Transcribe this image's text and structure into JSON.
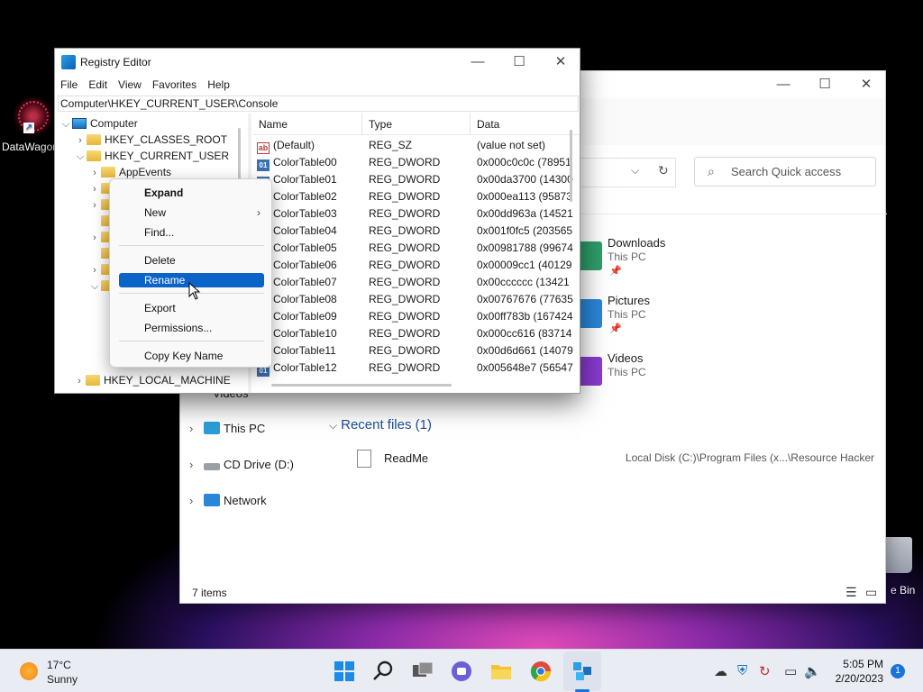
{
  "desktop": {
    "datawagon_label": "DataWagon",
    "bin_label": "e Bin"
  },
  "explorer": {
    "search_placeholder": "Search Quick access",
    "quick_access": [
      {
        "name": "Downloads",
        "sub": "This PC",
        "color": "#2e9e6a"
      },
      {
        "name": "Pictures",
        "sub": "This PC",
        "color": "#2a86d8"
      },
      {
        "name": "Videos",
        "sub": "This PC",
        "color": "#8a3ad0"
      }
    ],
    "nav": {
      "videos": "Videos",
      "this_pc": "This PC",
      "cd_drive": "CD Drive (D:)",
      "network": "Network"
    },
    "recent_header": "Recent files (1)",
    "recent_file": {
      "name": "ReadMe",
      "location": "Local Disk (C:)\\Program Files (x...\\Resource Hacker"
    },
    "status": "7 items"
  },
  "regedit": {
    "title": "Registry Editor",
    "menu": [
      "File",
      "Edit",
      "View",
      "Favorites",
      "Help"
    ],
    "address": "Computer\\HKEY_CURRENT_USER\\Console",
    "tree": {
      "computer": "Computer",
      "classes_root": "HKEY_CLASSES_ROOT",
      "current_user": "HKEY_CURRENT_USER",
      "appevents": "AppEvents",
      "local_machine": "HKEY_LOCAL_MACHINE"
    },
    "columns": {
      "name": "Name",
      "type": "Type",
      "data": "Data"
    },
    "values": [
      {
        "name": "(Default)",
        "type": "REG_SZ",
        "data": "(value not set)"
      },
      {
        "name": "ColorTable00",
        "type": "REG_DWORD",
        "data": "0x000c0c0c (78951"
      },
      {
        "name": "ColorTable01",
        "type": "REG_DWORD",
        "data": "0x00da3700 (14300"
      },
      {
        "name": "ColorTable02",
        "type": "REG_DWORD",
        "data": "0x000ea113 (95873"
      },
      {
        "name": "ColorTable03",
        "type": "REG_DWORD",
        "data": "0x00dd963a (14521"
      },
      {
        "name": "ColorTable04",
        "type": "REG_DWORD",
        "data": "0x001f0fc5 (203565"
      },
      {
        "name": "ColorTable05",
        "type": "REG_DWORD",
        "data": "0x00981788 (99674"
      },
      {
        "name": "ColorTable06",
        "type": "REG_DWORD",
        "data": "0x00009cc1 (40129"
      },
      {
        "name": "ColorTable07",
        "type": "REG_DWORD",
        "data": "0x00cccccc (13421"
      },
      {
        "name": "ColorTable08",
        "type": "REG_DWORD",
        "data": "0x00767676 (77635"
      },
      {
        "name": "ColorTable09",
        "type": "REG_DWORD",
        "data": "0x00ff783b (167424"
      },
      {
        "name": "ColorTable10",
        "type": "REG_DWORD",
        "data": "0x000cc616 (83714"
      },
      {
        "name": "ColorTable11",
        "type": "REG_DWORD",
        "data": "0x00d6d661 (14079"
      },
      {
        "name": "ColorTable12",
        "type": "REG_DWORD",
        "data": "0x005648e7 (56547"
      }
    ]
  },
  "context_menu": {
    "items": [
      "Expand",
      "New",
      "Find...",
      "Delete",
      "Rename",
      "Export",
      "Permissions...",
      "Copy Key Name"
    ],
    "selected": "Rename"
  },
  "taskbar": {
    "temperature": "17°C",
    "condition": "Sunny",
    "time": "5:05 PM",
    "date": "2/20/2023",
    "notification_count": "1"
  }
}
